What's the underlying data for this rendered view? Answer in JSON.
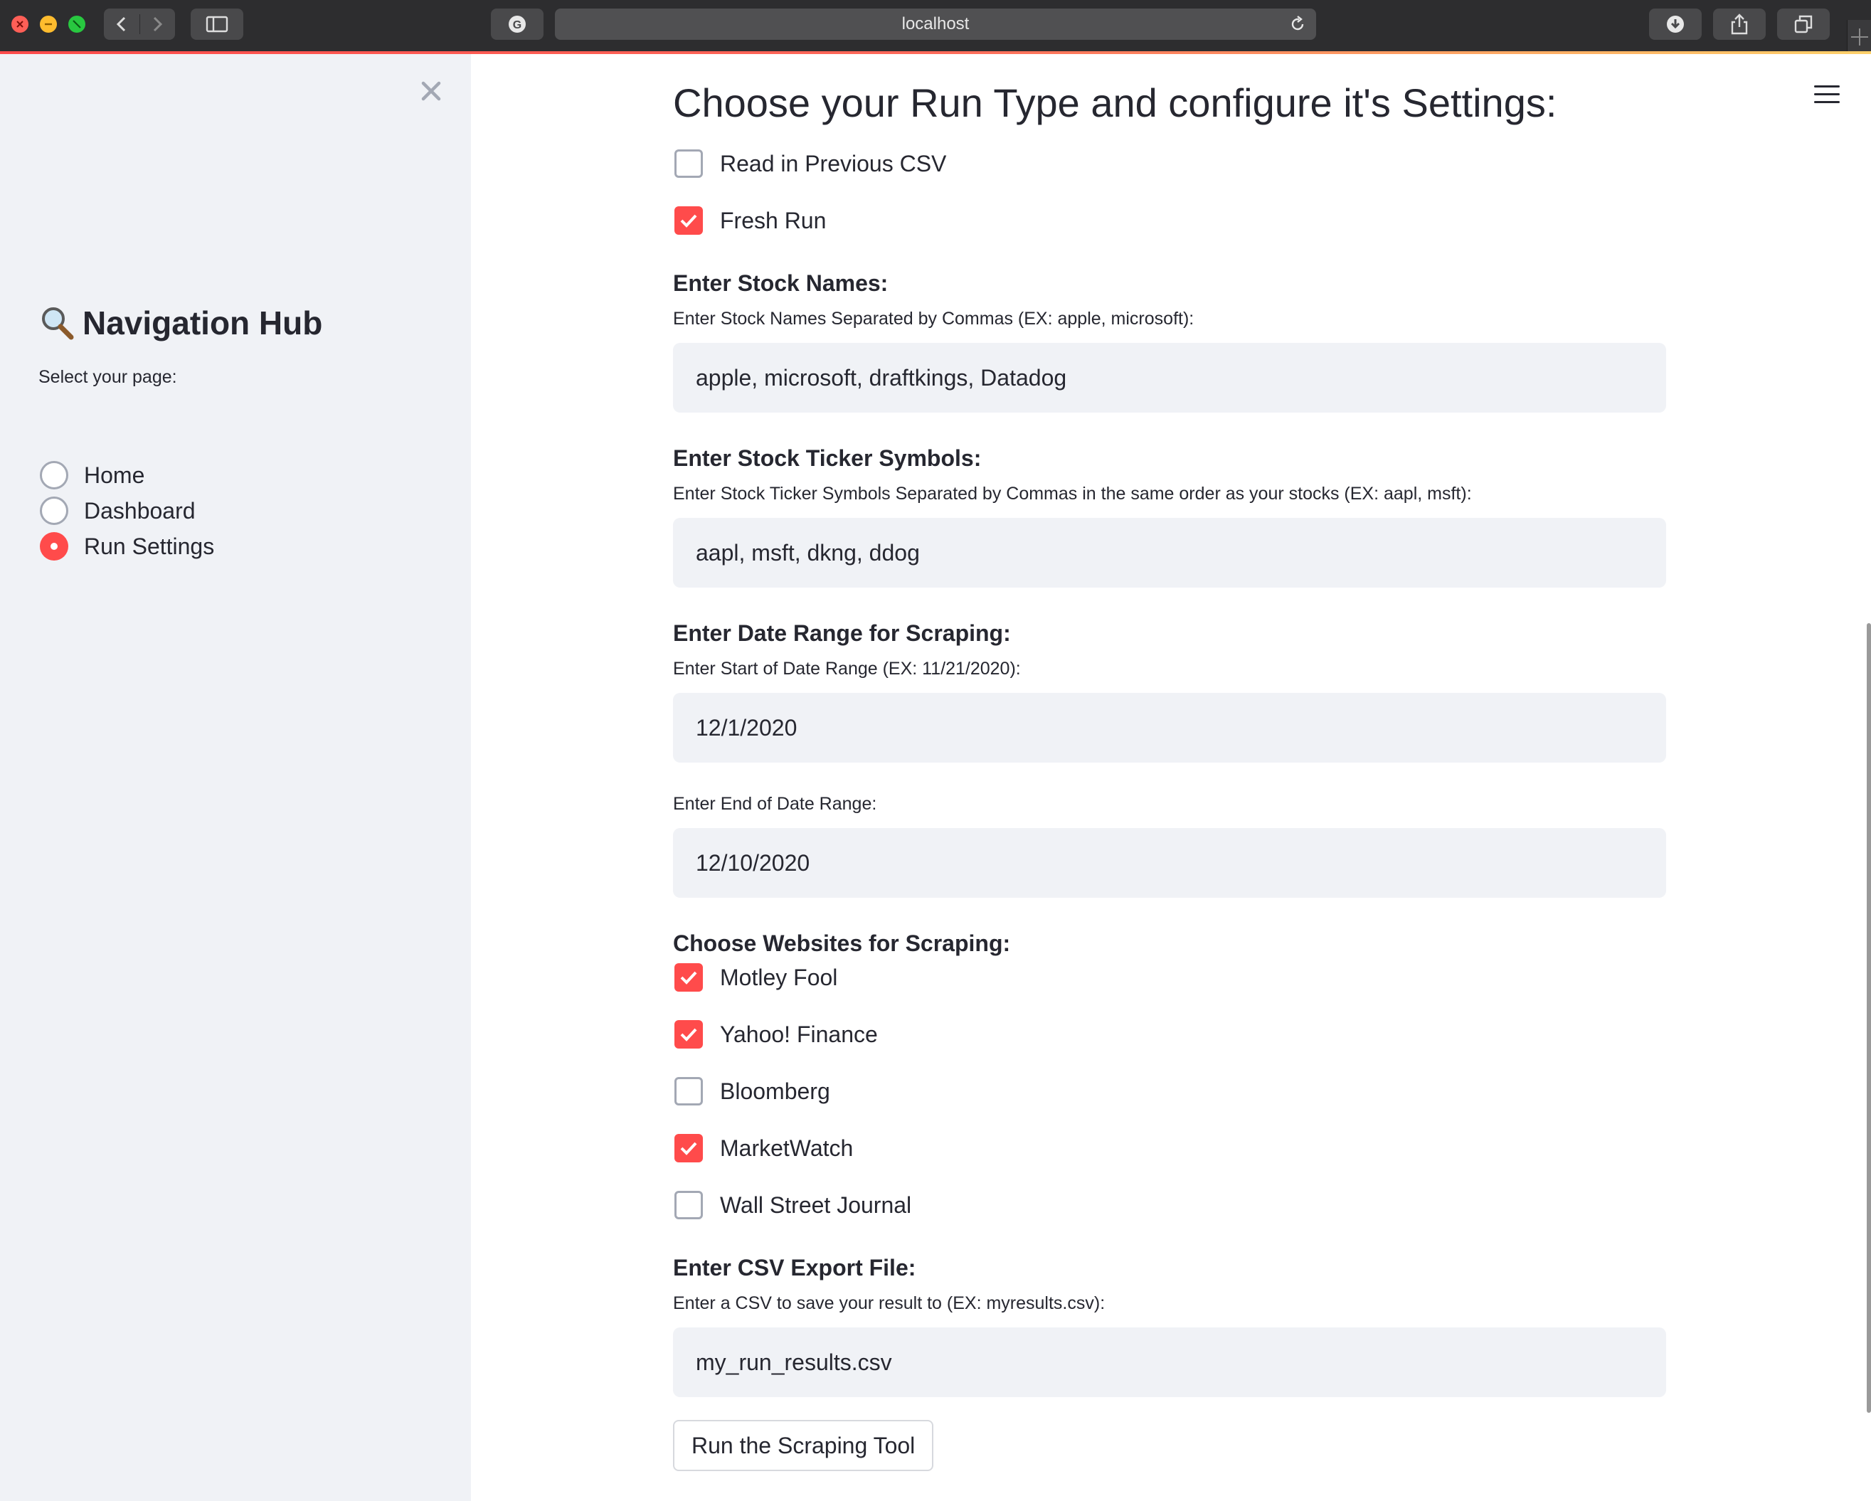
{
  "browser": {
    "url": "localhost"
  },
  "sidebar": {
    "title": "Navigation Hub",
    "select_label": "Select your page:",
    "pages": [
      {
        "label": "Home",
        "selected": false
      },
      {
        "label": "Dashboard",
        "selected": false
      },
      {
        "label": "Run Settings",
        "selected": true
      }
    ]
  },
  "main": {
    "title": "Choose your Run Type and configure it's Settings:",
    "run_type": [
      {
        "label": "Read in Previous CSV",
        "checked": false
      },
      {
        "label": "Fresh Run",
        "checked": true
      }
    ],
    "stock_names": {
      "heading": "Enter Stock Names:",
      "label": "Enter Stock Names Separated by Commas (EX: apple, microsoft):",
      "value": "apple, microsoft, draftkings, Datadog"
    },
    "ticker_symbols": {
      "heading": "Enter Stock Ticker Symbols:",
      "label": "Enter Stock Ticker Symbols Separated by Commas in the same order as your stocks (EX: aapl, msft):",
      "value": "aapl, msft, dkng, ddog"
    },
    "date_range": {
      "heading": "Enter Date Range for Scraping:",
      "start_label": "Enter Start of Date Range (EX: 11/21/2020):",
      "start_value": "12/1/2020",
      "end_label": "Enter End of Date Range:",
      "end_value": "12/10/2020"
    },
    "websites": {
      "heading": "Choose Websites for Scraping:",
      "options": [
        {
          "label": "Motley Fool",
          "checked": true
        },
        {
          "label": "Yahoo! Finance",
          "checked": true
        },
        {
          "label": "Bloomberg",
          "checked": false
        },
        {
          "label": "MarketWatch",
          "checked": true
        },
        {
          "label": "Wall Street Journal",
          "checked": false
        }
      ]
    },
    "csv_export": {
      "heading": "Enter CSV Export File:",
      "label": "Enter a CSV to save your result to (EX: myresults.csv):",
      "value": "my_run_results.csv"
    },
    "run_button": "Run the Scraping Tool"
  },
  "colors": {
    "accent": "#ff4b4b",
    "sidebar_bg": "#f0f2f6",
    "input_bg": "#f0f2f6",
    "text": "#262730"
  },
  "icons": {
    "sidebar_close": "close-icon",
    "menu": "hamburger-menu-icon",
    "nav_title": "magnifying-glass-icon"
  }
}
